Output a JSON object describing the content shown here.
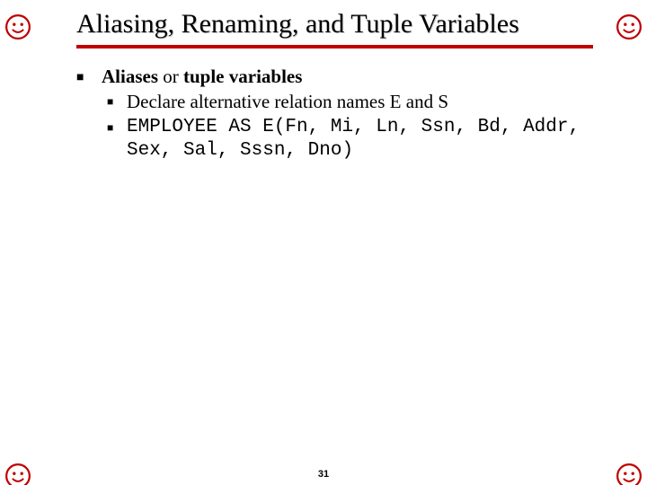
{
  "title": "Aliasing, Renaming, and Tuple Variables",
  "main": {
    "heading_b1": "Aliases",
    "heading_p1": " or ",
    "heading_b2": "tuple variables",
    "sub1": "Declare alternative relation names E and S",
    "sub2": "EMPLOYEE AS E(Fn, Mi, Ln, Ssn, Bd, Addr, Sex, Sal, Sssn, Dno)"
  },
  "page_number": "31",
  "icons": {
    "corner": "peace-hand-icon"
  }
}
